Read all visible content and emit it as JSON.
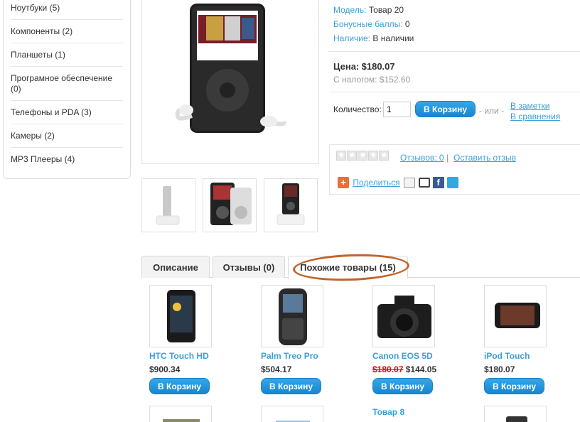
{
  "sidebar": {
    "items": [
      {
        "label": "Ноутбуки (5)"
      },
      {
        "label": "Компоненты (2)"
      },
      {
        "label": "Планшеты (1)"
      },
      {
        "label": "Програмное обеспечение (0)"
      },
      {
        "label": "Телефоны и PDA (3)"
      },
      {
        "label": "Камеры (2)"
      },
      {
        "label": "MP3 Плееры (4)"
      }
    ]
  },
  "product": {
    "model_label": "Модель:",
    "model_value": "Товар 20",
    "bonus_label": "Бонусные баллы:",
    "bonus_value": "0",
    "stock_label": "Наличие:",
    "stock_value": "В наличии",
    "price_label": "Цена:",
    "price_value": "$180.07",
    "tax_text": "С налогом: $152.60",
    "qty_label": "Количество:",
    "qty_value": "1",
    "cart_button": "В Корзину",
    "or_text": "- или -",
    "wishlist_link": "В заметки",
    "compare_link": "В сравнения",
    "reviews_link": "Отзывов: 0",
    "divider": "|",
    "write_review_link": "Оставить отзыв",
    "share_label": "Поделиться"
  },
  "tabs": [
    {
      "label": "Описание"
    },
    {
      "label": "Отзывы (0)"
    },
    {
      "label": "Похожие товары (15)"
    }
  ],
  "related": [
    {
      "name": "HTC Touch HD",
      "price": "$900.34",
      "old_price": "",
      "button": "В Корзину"
    },
    {
      "name": "Palm Treo Pro",
      "price": "$504.17",
      "old_price": "",
      "button": "В Корзину"
    },
    {
      "name": "Canon EOS 5D",
      "price": "$144.05",
      "old_price": "$180.07",
      "button": "В Корзину"
    },
    {
      "name": "iPod Touch",
      "price": "$180.07",
      "old_price": "",
      "button": "В Корзину"
    },
    {
      "name": "Товар 8",
      "price": "",
      "old_price": "",
      "button": ""
    }
  ],
  "colors": {
    "accent": "#3b9fd8",
    "button": "#1785d0",
    "highlight": "#c2642a",
    "sale": "#e00000"
  }
}
